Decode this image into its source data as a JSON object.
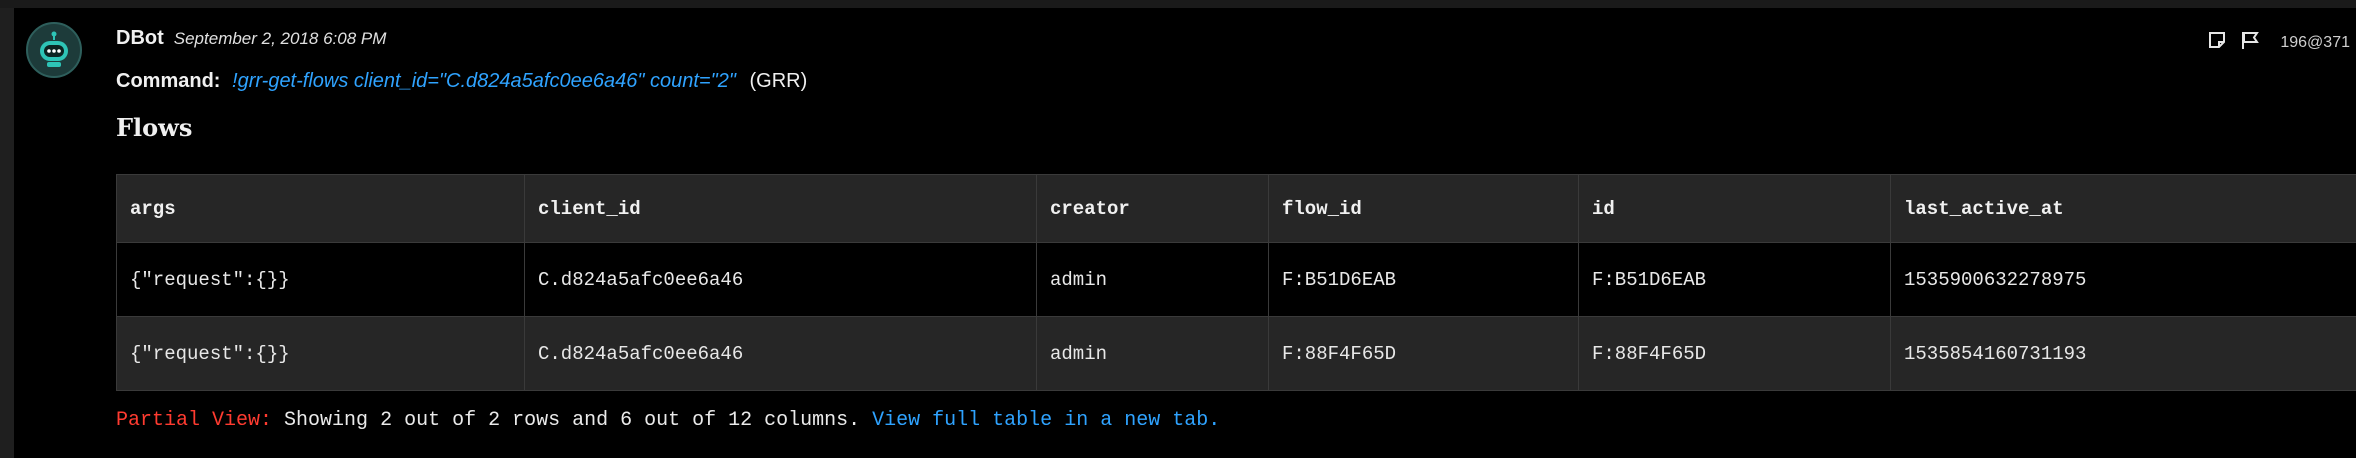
{
  "entry": {
    "author": "DBot",
    "timestamp": "September 2, 2018 6:08 PM",
    "entry_ref": "196@371",
    "avatar_icon": "robot-icon",
    "note_icon": "note-icon",
    "flag_icon": "flag-icon"
  },
  "command": {
    "label": "Command:",
    "text": "!grr-get-flows client_id=\"C.d824a5afc0ee6a46\" count=\"2\"",
    "brand": "(GRR)"
  },
  "section_title": "Flows",
  "table": {
    "columns": [
      "args",
      "client_id",
      "creator",
      "flow_id",
      "id",
      "last_active_at"
    ],
    "rows": [
      [
        "{\"request\":{}}",
        "C.d824a5afc0ee6a46",
        "admin",
        "F:B51D6EAB",
        "F:B51D6EAB",
        "1535900632278975"
      ],
      [
        "{\"request\":{}}",
        "C.d824a5afc0ee6a46",
        "admin",
        "F:88F4F65D",
        "F:88F4F65D",
        "1535854160731193"
      ]
    ]
  },
  "partial_view": {
    "label": "Partial View:",
    "text": "Showing 2 out of 2 rows and 6 out of 12 columns.",
    "link": "View full table in a new tab."
  },
  "colors": {
    "background": "#000000",
    "link": "#2fa3ff",
    "warning": "#ff3b30",
    "header_row": "#262626",
    "avatar_accent": "#2ec4b6"
  }
}
